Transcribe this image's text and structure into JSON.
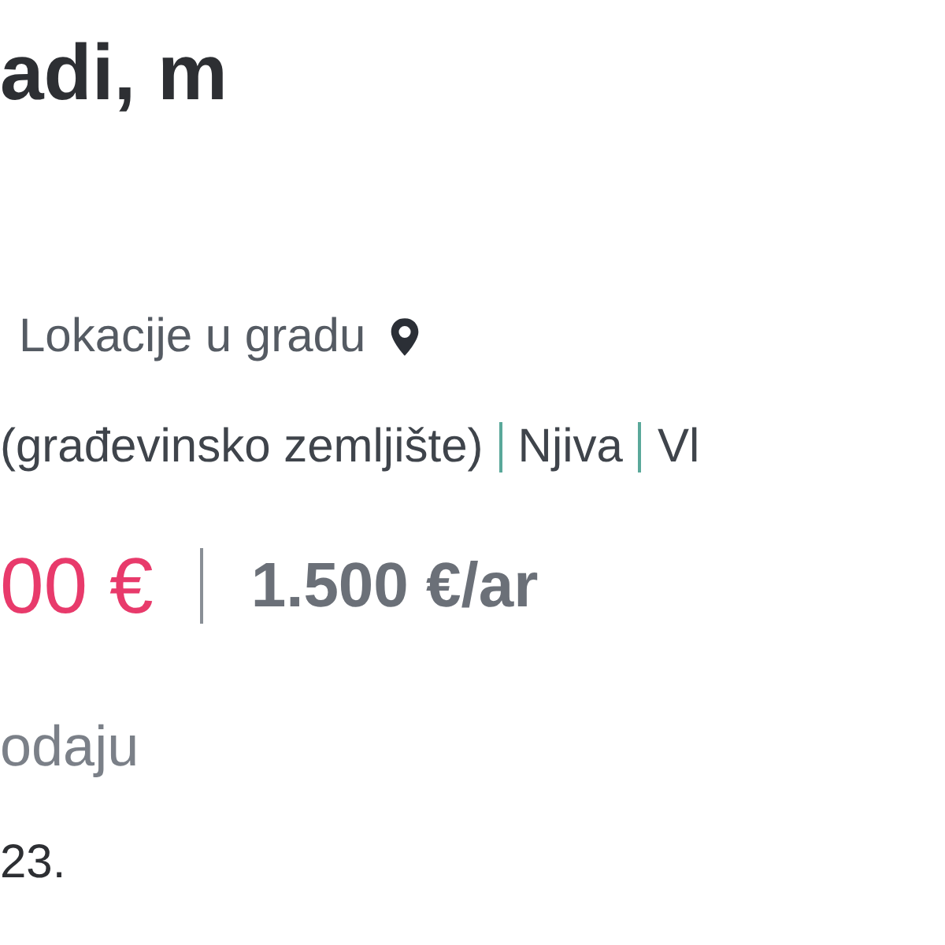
{
  "title": "adi, m",
  "location": "Lokacije u gradu",
  "categories": [
    "(građevinsko zemljište)",
    "Njiva",
    "Vl"
  ],
  "price": "00 €",
  "price_per_unit": "1.500 €/ar",
  "listing_type": "odaju",
  "date": "23."
}
